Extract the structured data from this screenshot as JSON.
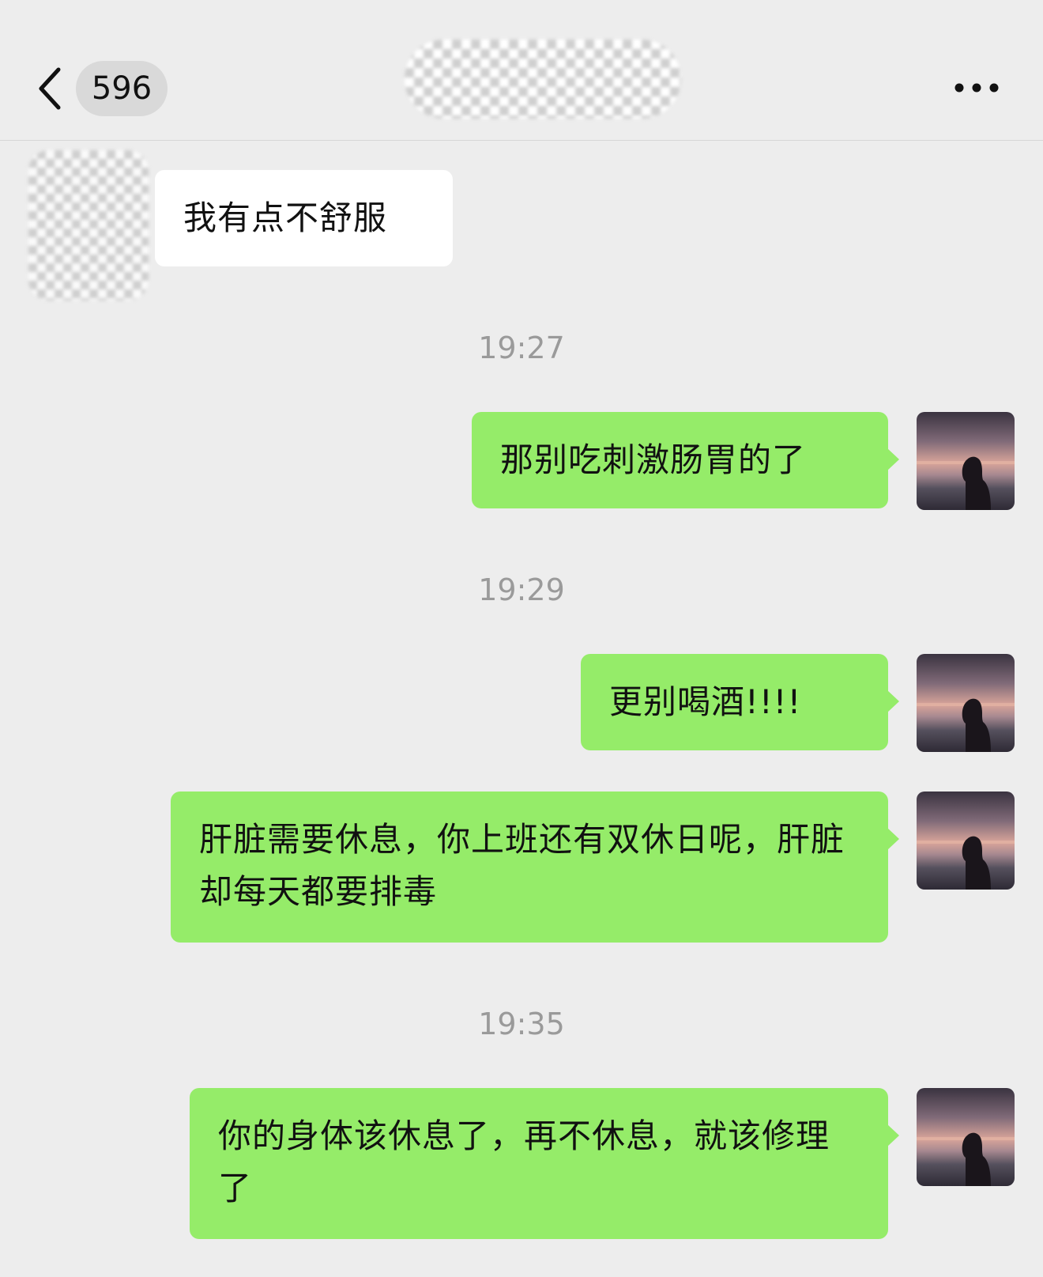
{
  "header": {
    "unread_count": "596",
    "contact_name": ""
  },
  "messages": [
    {
      "side": "in",
      "text": "我有点不舒服"
    },
    {
      "side": "out",
      "time": "19:27",
      "text": "那别吃刺激肠胃的了"
    },
    {
      "side": "out",
      "time": "19:29",
      "text": "更别喝酒!!!!"
    },
    {
      "side": "out",
      "text": "肝脏需要休息，你上班还有双休日呢，肝脏却每天都要排毒"
    },
    {
      "side": "out",
      "time": "19:35",
      "text": "你的身体该休息了，再不休息，就该修理了"
    }
  ],
  "icons": {
    "back": "chevron-left-icon",
    "more": "more-dots-icon"
  },
  "colors": {
    "background": "#ededed",
    "outgoing_bubble": "#95ec69",
    "incoming_bubble": "#ffffff",
    "timestamp_text": "#9a9a9a"
  }
}
